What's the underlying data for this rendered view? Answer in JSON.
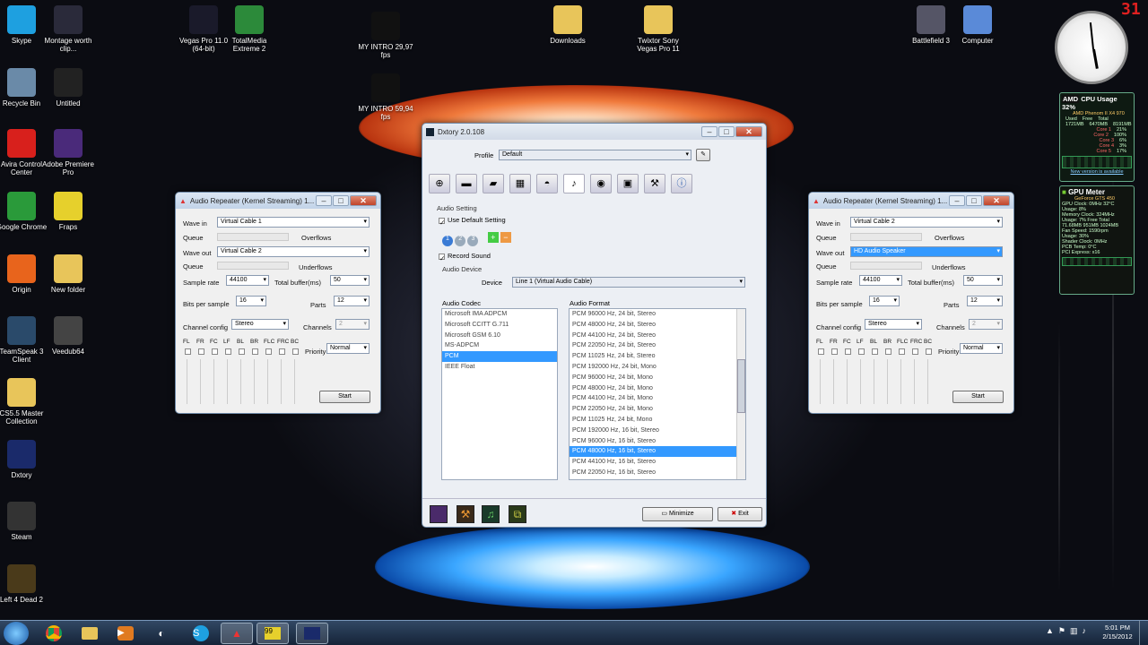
{
  "desktop_icons": [
    {
      "label": "Skype",
      "icon": "skype-icon",
      "color": "#1ea0e0"
    },
    {
      "label": "Montage worth clip...",
      "icon": "vegas-media-icon",
      "color": "#2a2a3a"
    },
    {
      "label": "Vegas Pro 11.0 (64-bit)",
      "icon": "vegas-icon",
      "color": "#1a1a2a"
    },
    {
      "label": "TotalMedia Extreme 2",
      "icon": "totalmedia-icon",
      "color": "#2c8a3a"
    },
    {
      "label": "MY INTRO 29,97 fps",
      "icon": "video-file-icon",
      "color": "#111"
    },
    {
      "label": "Downloads",
      "icon": "folder-icon",
      "color": "#e8c55a"
    },
    {
      "label": "Twixtor Sony Vegas Pro 11",
      "icon": "folder-icon",
      "color": "#e8c55a"
    },
    {
      "label": "Battlefield 3",
      "icon": "battlefield-icon",
      "color": "#556"
    },
    {
      "label": "Computer",
      "icon": "computer-icon",
      "color": "#5a8ad8"
    },
    {
      "label": "Recycle Bin",
      "icon": "recycle-bin-icon",
      "color": "#6a8aa8"
    },
    {
      "label": "Untitled",
      "icon": "video-file-icon",
      "color": "#222"
    },
    {
      "label": "MY INTRO 59,94 fps",
      "icon": "video-file-icon",
      "color": "#111"
    },
    {
      "label": "Avira Control Center",
      "icon": "avira-icon",
      "color": "#d8201c"
    },
    {
      "label": "Adobe Premiere Pro",
      "icon": "premiere-icon",
      "color": "#4a2a7a"
    },
    {
      "label": "Google Chrome",
      "icon": "chrome-icon",
      "color": "#2a9a3a"
    },
    {
      "label": "Fraps",
      "icon": "fraps-icon",
      "color": "#e6d02c"
    },
    {
      "label": "Origin",
      "icon": "origin-icon",
      "color": "#e8641c"
    },
    {
      "label": "New folder",
      "icon": "folder-icon",
      "color": "#e8c55a"
    },
    {
      "label": "TeamSpeak 3 Client",
      "icon": "teamspeak-icon",
      "color": "#2a4a6a"
    },
    {
      "label": "Veedub64",
      "icon": "gear-icon",
      "color": "#444"
    },
    {
      "label": "CS5.5 Master Collection",
      "icon": "folder-icon",
      "color": "#e8c55a"
    },
    {
      "label": "Dxtory",
      "icon": "dxtory-icon",
      "color": "#1a2a6a"
    },
    {
      "label": "Steam",
      "icon": "steam-icon",
      "color": "#333"
    },
    {
      "label": "Left 4 Dead 2",
      "icon": "l4d2-icon",
      "color": "#4a3a1a"
    }
  ],
  "clock": {
    "time": "5:01 PM",
    "date": "2/15/2012",
    "calendar_day": "31"
  },
  "cpu_gadget": {
    "title": "CPU Usage",
    "percent": "32%",
    "cpu_name": "AMD Phenom II X4 970",
    "used_label": "Used",
    "free_label": "Free",
    "total_label": "Total",
    "used": "1721MB",
    "free": "6470MB",
    "total": "8191MB",
    "cores": [
      {
        "name": "Core 1",
        "value": "21%"
      },
      {
        "name": "Core 2",
        "value": "100%"
      },
      {
        "name": "Core 3",
        "value": "6%"
      },
      {
        "name": "Core 4",
        "value": "3%"
      },
      {
        "name": "Core 5",
        "value": "17%"
      }
    ],
    "link": "New version is available"
  },
  "gpu_gadget": {
    "title": "GPU Meter",
    "card": "GeForce GTS 450",
    "lines": [
      "GPU Clock: 0MHz  32°C",
      "Usage: 8%",
      "Memory Clock: 324MHz",
      "Usage: 7%   Free  Total",
      "71.68MB  951MB  1024MB",
      "Fan Speed: 1590rpm",
      "Usage: 30%",
      "Shader Clock: 0MHz",
      "PCB Temp: 0°C",
      "PCI Express: x16"
    ]
  },
  "repeater_left": {
    "title": "Audio Repeater (Kernel Streaming) 1...",
    "wave_in_label": "Wave in",
    "wave_in": "Virtual Cable 1",
    "queue_label": "Queue",
    "overflows_label": "Overflows",
    "wave_out_label": "Wave out",
    "wave_out": "Virtual Cable 2",
    "underflows_label": "Underflows",
    "sample_rate_label": "Sample rate",
    "sample_rate": "44100",
    "total_buffer_label": "Total buffer(ms)",
    "total_buffer": "50",
    "bits_label": "Bits per sample",
    "bits": "16",
    "parts_label": "Parts",
    "parts": "12",
    "channel_config_label": "Channel config",
    "channel_config": "Stereo",
    "channels_label": "Channels",
    "channels": "2",
    "speakers": [
      "FL",
      "FR",
      "FC",
      "LF",
      "BL",
      "BR",
      "FLC",
      "FRC",
      "BC"
    ],
    "priority_label": "Priority",
    "priority": "Normal",
    "start_label": "Start"
  },
  "repeater_right": {
    "title": "Audio Repeater (Kernel Streaming) 1...",
    "wave_in_label": "Wave in",
    "wave_in": "Virtual Cable 2",
    "queue_label": "Queue",
    "overflows_label": "Overflows",
    "wave_out_label": "Wave out",
    "wave_out": "HD Audio Speaker",
    "underflows_label": "Underflows",
    "sample_rate_label": "Sample rate",
    "sample_rate": "44100",
    "total_buffer_label": "Total buffer(ms)",
    "total_buffer": "50",
    "bits_label": "Bits per sample",
    "bits": "16",
    "parts_label": "Parts",
    "parts": "12",
    "channel_config_label": "Channel config",
    "channel_config": "Stereo",
    "channels_label": "Channels",
    "channels": "2",
    "speakers": [
      "FL",
      "FR",
      "FC",
      "LF",
      "BL",
      "BR",
      "FLC",
      "FRC",
      "BC"
    ],
    "priority_label": "Priority",
    "priority": "Normal",
    "start_label": "Start"
  },
  "dxtory": {
    "title": "Dxtory 2.0.108",
    "profile_label": "Profile",
    "profile": "Default",
    "audio_setting_label": "Audio Setting",
    "use_default_label": "Use Default Setting",
    "record_sound_label": "Record Sound",
    "audio_device_label": "Audio Device",
    "device_label": "Device",
    "device": "Line 1 (Virtual Audio Cable)",
    "codec_label": "Audio Codec",
    "format_label": "Audio Format",
    "codecs": [
      "Microsoft IMA ADPCM",
      "Microsoft CCITT G.711",
      "Microsoft GSM 6.10",
      "MS-ADPCM",
      "PCM",
      "IEEE Float"
    ],
    "selected_codec": 4,
    "formats": [
      "PCM 96000 Hz, 24 bit, Stereo",
      "PCM 48000 Hz, 24 bit, Stereo",
      "PCM 44100 Hz, 24 bit, Stereo",
      "PCM 22050 Hz, 24 bit, Stereo",
      "PCM 11025 Hz, 24 bit, Stereo",
      "PCM 192000 Hz, 24 bit, Mono",
      "PCM 96000 Hz, 24 bit, Mono",
      "PCM 48000 Hz, 24 bit, Mono",
      "PCM 44100 Hz, 24 bit, Mono",
      "PCM 22050 Hz, 24 bit, Mono",
      "PCM 11025 Hz, 24 bit, Mono",
      "PCM 192000 Hz, 16 bit, Stereo",
      "PCM 96000 Hz, 16 bit, Stereo",
      "PCM 48000 Hz, 16 bit, Stereo",
      "PCM 44100 Hz, 16 bit, Stereo",
      "PCM 22050 Hz, 16 bit, Stereo"
    ],
    "selected_format": 13,
    "minimize_label": "Minimize",
    "exit_label": "Exit"
  }
}
